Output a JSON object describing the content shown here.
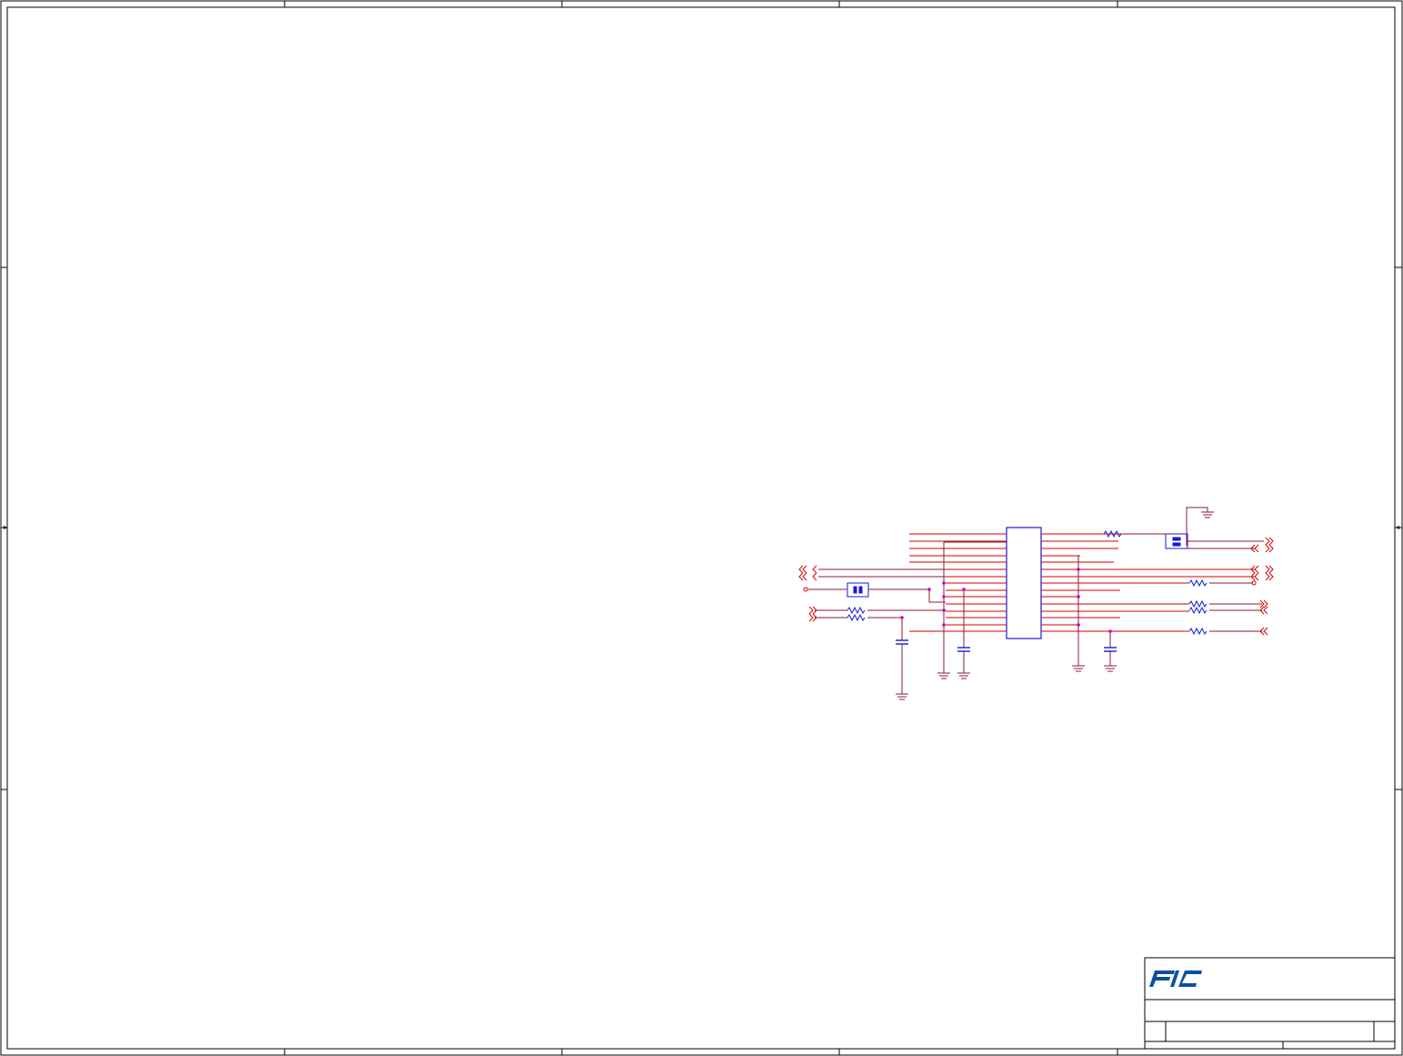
{
  "sheet": {
    "title": "",
    "border_color": "#000000"
  },
  "colors": {
    "wire": "#8b1a3a",
    "net_red": "#d40000",
    "component_blue": "#1a1acc",
    "junction_magenta": "#cc00cc",
    "ground": "#8b1a3a",
    "logo_blue": "#0b4fa0"
  },
  "title_block": {
    "logo_text": "FIC",
    "company": "",
    "doc_title": "",
    "rev": "",
    "sheet_no": ""
  },
  "schematic": {
    "ic_label": "",
    "components": [
      {
        "kind": "resistor",
        "name": "resistor-top-right"
      },
      {
        "kind": "connector",
        "name": "jumper-top-right"
      },
      {
        "kind": "connector",
        "name": "jumper-left"
      },
      {
        "kind": "resistor",
        "name": "resistor-left-1"
      },
      {
        "kind": "resistor",
        "name": "resistor-left-2"
      },
      {
        "kind": "capacitor",
        "name": "capacitor-left"
      },
      {
        "kind": "capacitor",
        "name": "capacitor-mid"
      },
      {
        "kind": "capacitor",
        "name": "capacitor-right"
      },
      {
        "kind": "resistor",
        "name": "resistor-right-1"
      },
      {
        "kind": "resistor",
        "name": "resistor-right-2"
      },
      {
        "kind": "resistor",
        "name": "resistor-right-3"
      },
      {
        "kind": "resistor",
        "name": "resistor-right-4"
      }
    ]
  }
}
